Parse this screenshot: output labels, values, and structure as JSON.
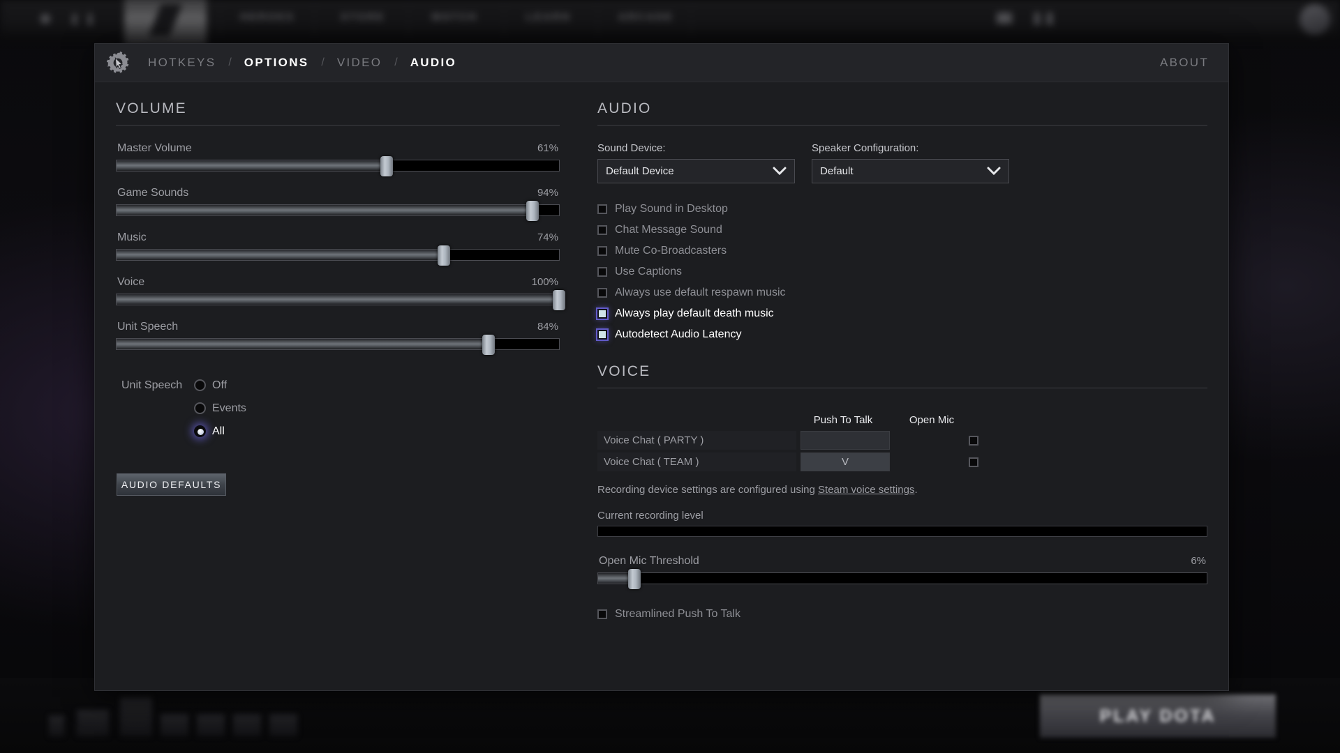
{
  "background": {
    "nav_items": [
      "HEROES",
      "STORE",
      "WATCH",
      "LEARN",
      "ARCADE"
    ],
    "play_button": "PLAY DOTA"
  },
  "header": {
    "gear_icon": "gear-cursor-icon",
    "breadcrumb": [
      {
        "label": "HOTKEYS",
        "active": false
      },
      {
        "label": "OPTIONS",
        "active": true
      },
      {
        "label": "VIDEO",
        "active": false
      },
      {
        "label": "AUDIO",
        "active": true
      }
    ],
    "separator": "/",
    "about": "ABOUT"
  },
  "volume": {
    "title": "VOLUME",
    "sliders": [
      {
        "label": "Master Volume",
        "value": "61%",
        "percent": 61
      },
      {
        "label": "Game Sounds",
        "value": "94%",
        "percent": 94
      },
      {
        "label": "Music",
        "value": "74%",
        "percent": 74
      },
      {
        "label": "Voice",
        "value": "100%",
        "percent": 100
      },
      {
        "label": "Unit Speech",
        "value": "84%",
        "percent": 84
      }
    ],
    "unit_speech": {
      "label": "Unit Speech",
      "options": [
        {
          "label": "Off",
          "selected": false
        },
        {
          "label": "Events",
          "selected": false
        },
        {
          "label": "All",
          "selected": true
        }
      ]
    },
    "defaults_button": "AUDIO DEFAULTS"
  },
  "audio": {
    "title": "AUDIO",
    "sound_device": {
      "label": "Sound Device:",
      "value": "Default Device",
      "icon": "chevron-down-icon"
    },
    "speaker_config": {
      "label": "Speaker Configuration:",
      "value": "Default",
      "icon": "chevron-down-icon"
    },
    "checkboxes": [
      {
        "label": "Play Sound in Desktop",
        "checked": false
      },
      {
        "label": "Chat Message Sound",
        "checked": false
      },
      {
        "label": "Mute Co-Broadcasters",
        "checked": false
      },
      {
        "label": "Use Captions",
        "checked": false
      },
      {
        "label": "Always use default respawn music",
        "checked": false
      },
      {
        "label": "Always play default death music",
        "checked": true
      },
      {
        "label": "Autodetect Audio Latency",
        "checked": true
      }
    ]
  },
  "voice": {
    "title": "VOICE",
    "columns": {
      "push_to_talk": "Push To Talk",
      "open_mic": "Open Mic"
    },
    "rows": [
      {
        "name": "Voice Chat ( PARTY )",
        "key": "",
        "open_mic": false
      },
      {
        "name": "Voice Chat ( TEAM )",
        "key": "V",
        "open_mic": false
      }
    ],
    "note_prefix": "Recording device settings are configured using ",
    "note_link": "Steam voice settings",
    "note_suffix": ".",
    "recording_level_label": "Current recording level",
    "threshold": {
      "label": "Open Mic Threshold",
      "value": "6%",
      "percent": 6
    },
    "streamlined": {
      "label": "Streamlined Push To Talk",
      "checked": false
    }
  },
  "colors": {
    "accent_glow": "#6860d8",
    "panel_bg": "#1c1d20",
    "header_bg": "#232428",
    "text_dim": "#9d9ea4",
    "text_bright": "#ffffff"
  }
}
